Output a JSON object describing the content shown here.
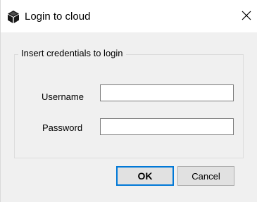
{
  "window": {
    "title": "Login to cloud",
    "icon": "cube-icon"
  },
  "group": {
    "legend": "Insert credentials to login"
  },
  "fields": {
    "username": {
      "label": "Username",
      "value": ""
    },
    "password": {
      "label": "Password",
      "value": ""
    }
  },
  "buttons": {
    "ok_label": "OK",
    "cancel_label": "Cancel"
  },
  "colors": {
    "dialog_bg": "#f0f0f0",
    "titlebar_bg": "#ffffff",
    "default_button_border": "#0078d7",
    "button_bg": "#e1e1e1"
  }
}
